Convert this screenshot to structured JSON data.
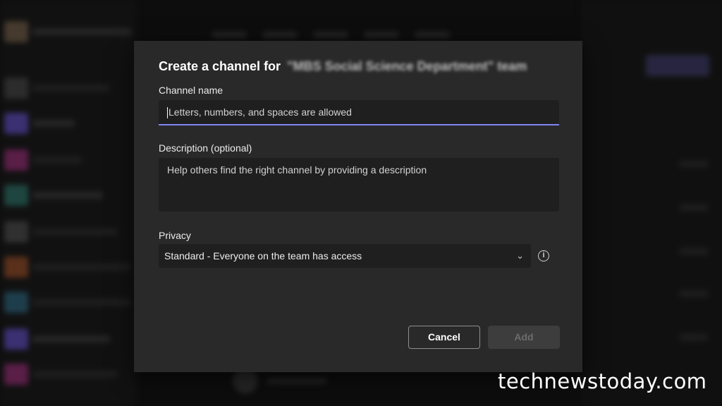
{
  "dialog": {
    "title_prefix": "Create a channel for",
    "team_name": "\"MBS Social Science Department\" team",
    "channel_name_label": "Channel name",
    "channel_name_placeholder": "Letters, numbers, and spaces are allowed",
    "description_label": "Description (optional)",
    "description_placeholder": "Help others find the right channel by providing a description",
    "privacy_label": "Privacy",
    "privacy_value": "Standard - Everyone on the team has access",
    "privacy_chevron_icon": "chevron-down-icon",
    "info_icon": "info-icon",
    "cancel_label": "Cancel",
    "add_label": "Add"
  },
  "watermark": "technewstoday.com",
  "colors": {
    "accent_underline": "#7f85f5",
    "dialog_bg": "#292929",
    "field_bg": "#1f1f1f"
  }
}
